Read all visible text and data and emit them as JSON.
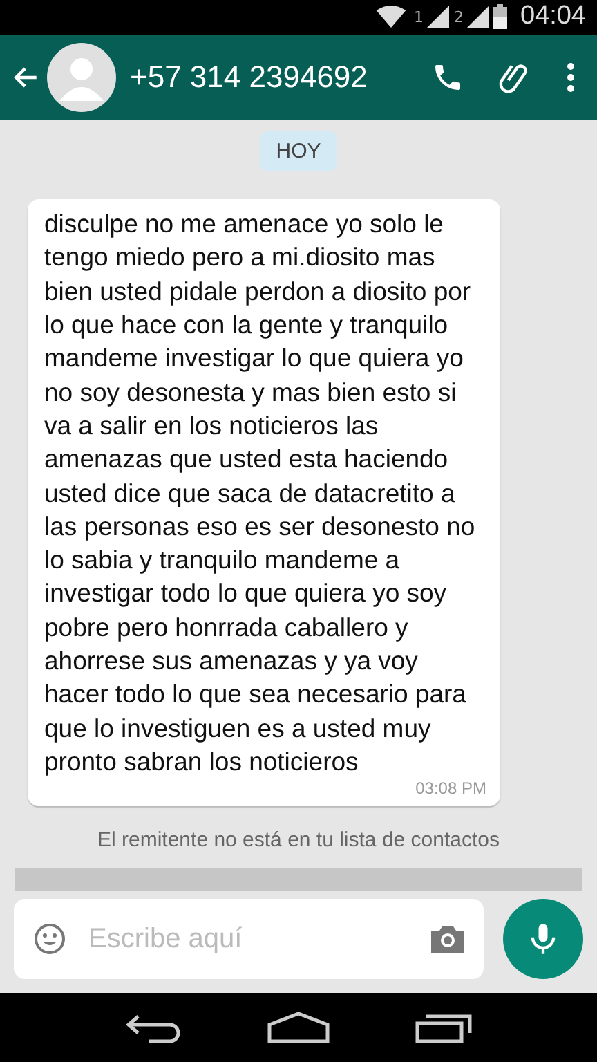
{
  "status_bar": {
    "sim_1": "1",
    "sim_2": "2",
    "time": "04:04"
  },
  "header": {
    "title": "+57 314 2394692"
  },
  "date_chip": "HOY",
  "messages": [
    {
      "text": "disculpe no me amenace yo solo le tengo miedo pero a mi.diosito mas bien usted pidale perdon a diosito por lo que hace con la gente y tranquilo mandeme investigar lo que quiera yo no soy desonesta y mas bien esto si va a salir en los noticieros las amenazas que usted esta haciendo usted dice que saca de datacretito a las personas eso es ser desonesto no lo sabia y tranquilo mandeme a investigar todo lo que quiera yo soy pobre pero honrrada caballero y ahorrese sus amenazas y ya voy hacer todo lo que sea necesario para que lo investiguen es a usted muy pronto sabran los noticieros",
      "time": "03:08 PM"
    }
  ],
  "notice": "El remitente no está en tu lista de contactos",
  "composer": {
    "placeholder": "Escribe aquí"
  }
}
